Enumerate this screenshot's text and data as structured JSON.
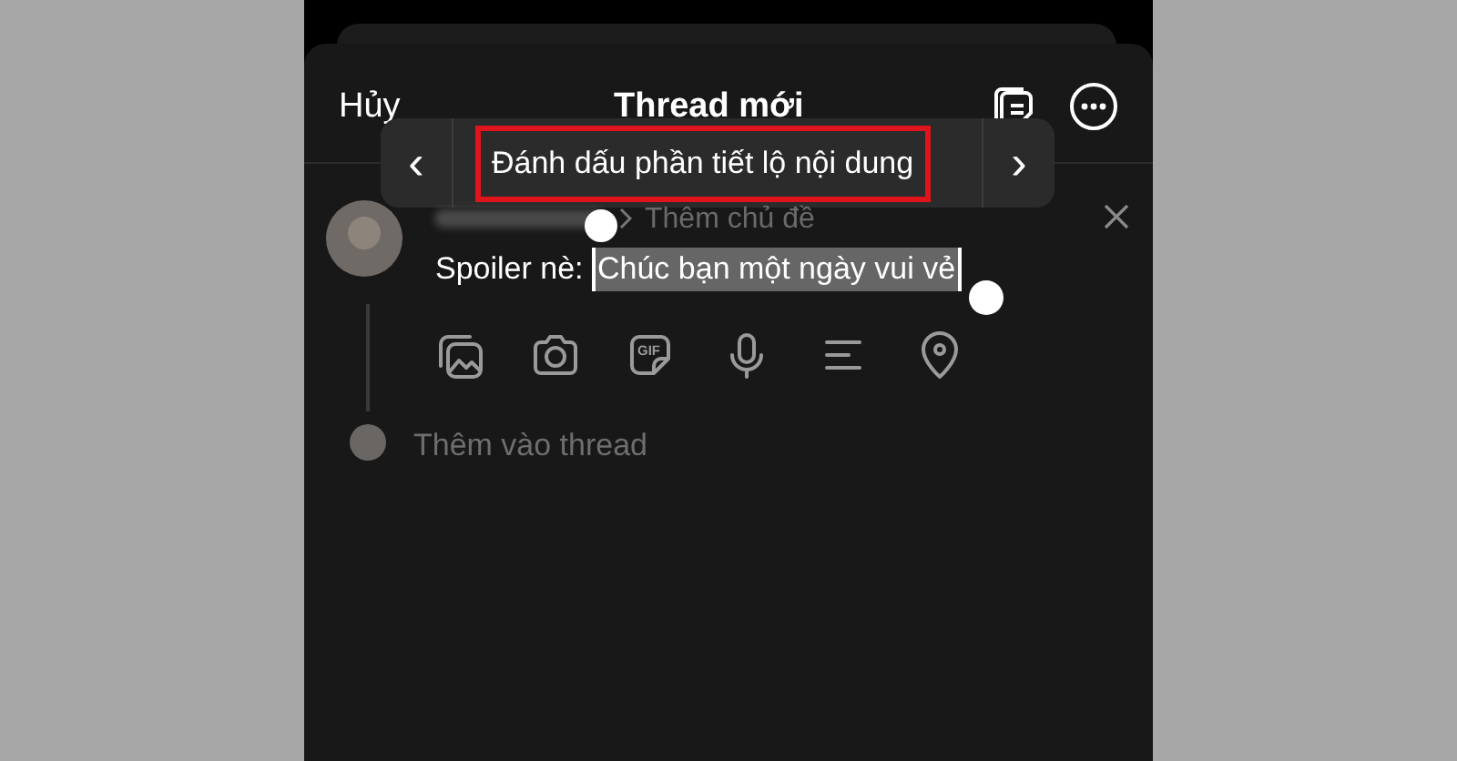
{
  "header": {
    "cancel": "Hủy",
    "title": "Thread mới"
  },
  "context_menu": {
    "prev": "‹",
    "label": "Đánh dấu phần tiết lộ nội dung",
    "next": "›",
    "highlighted": true
  },
  "post": {
    "topic_placeholder": "Thêm chủ đề",
    "text": "Spoiler nè: ",
    "selected_text": "Chúc bạn một ngày vui vẻ"
  },
  "gif_button": "GIF",
  "add_to_thread": "Thêm vào thread"
}
